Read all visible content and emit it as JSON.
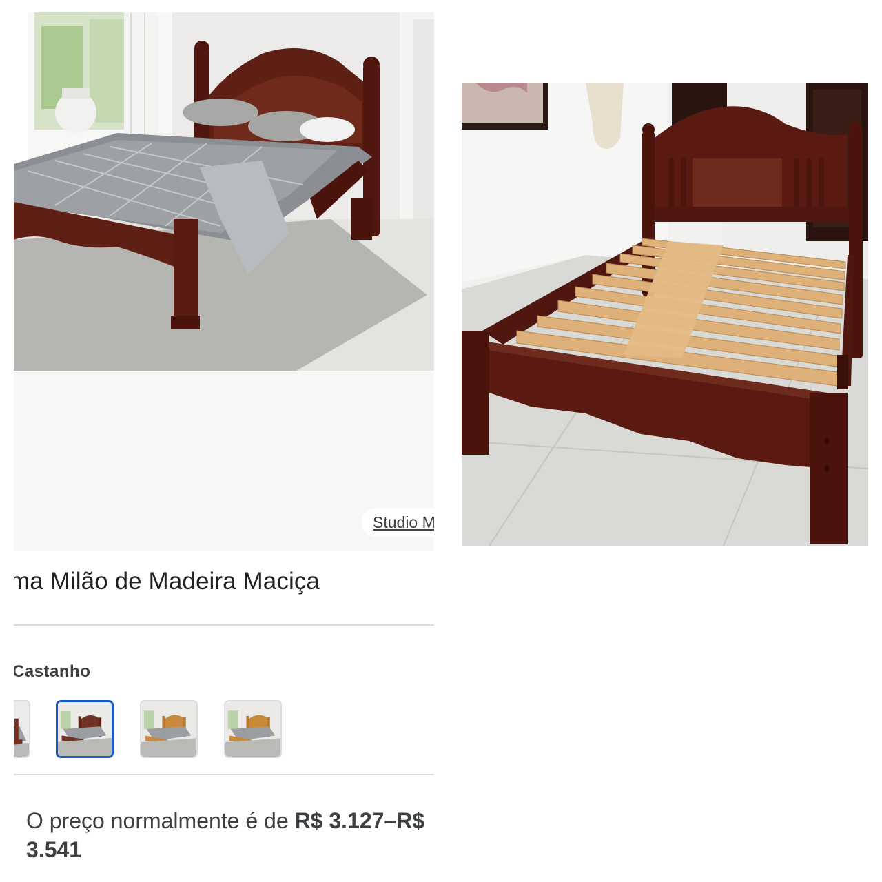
{
  "store": {
    "chip_text": "Studio M"
  },
  "product": {
    "title": "ma Milão de Madeira Maciça",
    "color_label": "Castanho",
    "swatches": [
      {
        "name": "dark-brown",
        "selected": false,
        "color": "#7a2e22"
      },
      {
        "name": "castanho",
        "selected": true,
        "color": "#6e3324"
      },
      {
        "name": "natural-pine",
        "selected": false,
        "color": "#c9893e"
      },
      {
        "name": "honey-pine",
        "selected": false,
        "color": "#c98a38"
      }
    ],
    "price": {
      "prefix": "O preço normalmente é de ",
      "range": "R$ 3.127–R$ 3.541"
    }
  },
  "colors": {
    "wood_dark": "#5a1a12",
    "wood_mid": "#6e2a1c",
    "slat": "#deb17a",
    "selected_border": "#1a5cc8"
  }
}
